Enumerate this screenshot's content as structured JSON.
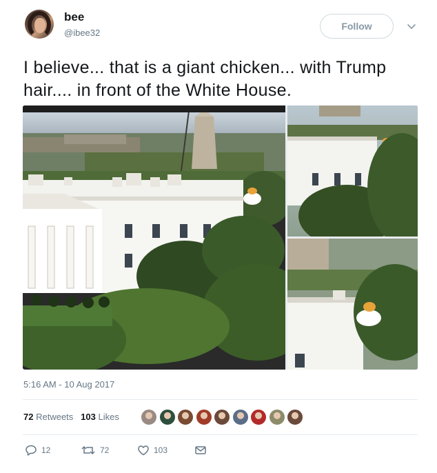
{
  "user": {
    "name": "bee",
    "handle": "@ibee32"
  },
  "follow_label": "Follow",
  "tweet_text": "I believe... that is a giant chicken... with Trump hair.... in front of the White House.",
  "timestamp": "5:16 AM - 10 Aug 2017",
  "stats": {
    "retweets_count": "72",
    "retweets_label": "Retweets",
    "likes_count": "103",
    "likes_label": "Likes"
  },
  "likers": [
    "#9a8a84",
    "#2e4f3d",
    "#7a4a32",
    "#a03b28",
    "#6b4a3a",
    "#5a6e8a",
    "#b32a2a",
    "#8c8c6a",
    "#6a4a3a"
  ],
  "actions": {
    "replies": "12",
    "retweets": "72",
    "likes": "103"
  },
  "colors": {
    "text": "#14171a",
    "muted": "#657786",
    "border": "#e6ecf0"
  }
}
